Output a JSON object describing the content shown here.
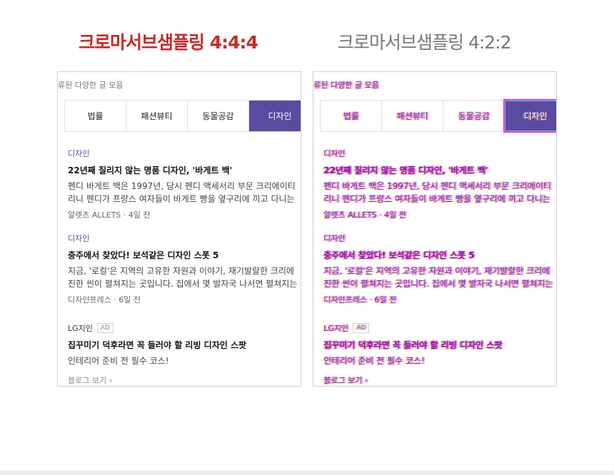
{
  "headings": {
    "left": "크로마서브샘플링 4:4:4",
    "right": "크로마서브샘플링 4:2:2"
  },
  "panel": {
    "crumb": "류된 다양한 글 모음",
    "tabs": [
      {
        "label": "법률"
      },
      {
        "label": "패션뷰티"
      },
      {
        "label": "동물공감"
      },
      {
        "label": "디자인"
      }
    ],
    "active_tab": "디자인",
    "articles": [
      {
        "category": "디자인",
        "title": "22년째 질리지 않는 명품 디자인, '바게트 백'",
        "desc1": "펜디 바게트 백은 1997년, 당시 펜디 액세서리 부문 크리에이티",
        "desc2": "리니 펜디가 프랑스 여자들이 바게트 빵을 옆구리에 끼고 다니는",
        "meta": "알렛츠 ALLETS · 4일 전"
      },
      {
        "category": "디자인",
        "title": "충주에서 찾았다! 보석같은 디자인 스폿 5",
        "desc1": "지금, '로컬'은 지역의 고유한 자원과 이야기, 재기발랄한 크리에",
        "desc2": "진한 씬이 펼쳐지는 곳입니다. 집에서 몇 발자국 나서면 펼쳐지는",
        "meta": "디자인프레스 · 6일 전"
      }
    ],
    "ad": {
      "brand": "LG지인",
      "badge": "AD",
      "title": "집꾸미기 덕후라면 꼭 들러야 할 리빙 디자인 스팟",
      "desc": "인테리어 준비 전 필수 코스!",
      "more": "블로그 보기 ›"
    }
  },
  "colors": {
    "heading_left": "#c62a2a",
    "heading_right": "#777777",
    "accent_tab": "#5a4aa0"
  }
}
